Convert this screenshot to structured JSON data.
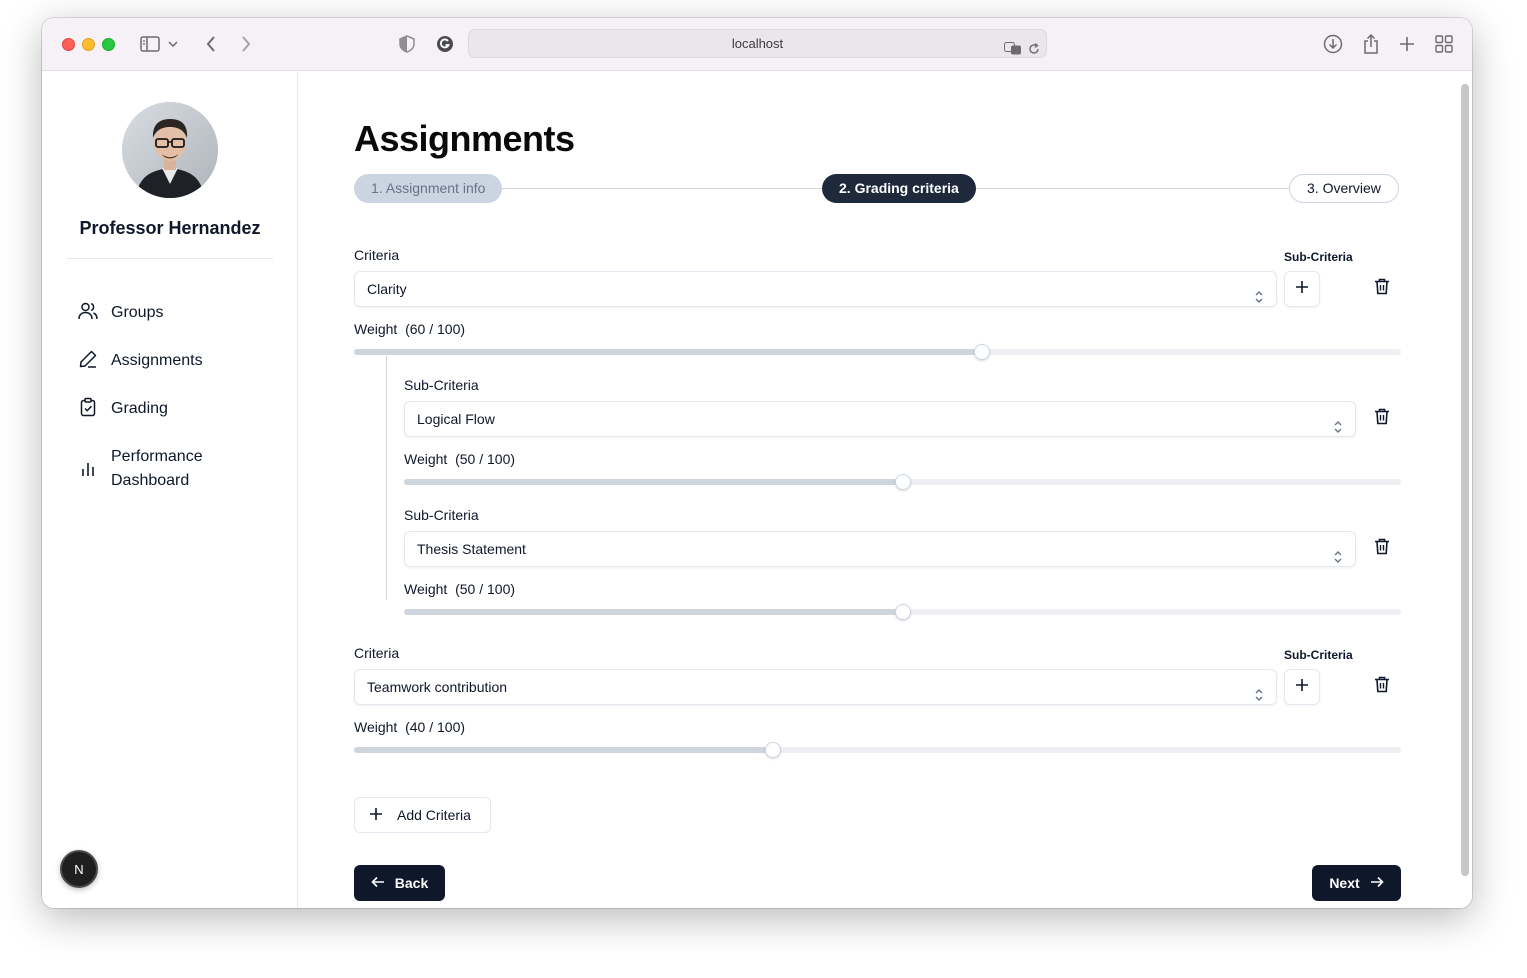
{
  "browser": {
    "url": "localhost"
  },
  "sidebar": {
    "user_name": "Professor Hernandez",
    "items": [
      {
        "label": "Groups",
        "icon": "users-icon"
      },
      {
        "label": "Assignments",
        "icon": "pencil-icon"
      },
      {
        "label": "Grading",
        "icon": "clipboard-check-icon"
      },
      {
        "label": "Performance Dashboard",
        "icon": "bar-chart-icon"
      }
    ],
    "badge": "N"
  },
  "main": {
    "title": "Assignments",
    "steps": [
      {
        "label": "1. Assignment info",
        "state": "done"
      },
      {
        "label": "2. Grading criteria",
        "state": "active"
      },
      {
        "label": "3. Overview",
        "state": "todo"
      }
    ],
    "criteria": [
      {
        "label": "Criteria",
        "sub_header": "Sub-Criteria",
        "value": "Clarity",
        "weight_label": "Weight",
        "weight_text": "(60 / 100)",
        "weight": 60,
        "sub_criteria": [
          {
            "label": "Sub-Criteria",
            "value": "Logical Flow",
            "weight_label": "Weight",
            "weight_text": "(50 / 100)",
            "weight": 50
          },
          {
            "label": "Sub-Criteria",
            "value": "Thesis Statement",
            "weight_label": "Weight",
            "weight_text": "(50 / 100)",
            "weight": 50
          }
        ]
      },
      {
        "label": "Criteria",
        "sub_header": "Sub-Criteria",
        "value": "Teamwork contribution",
        "weight_label": "Weight",
        "weight_text": "(40 / 100)",
        "weight": 40,
        "sub_criteria": []
      }
    ],
    "add_label": "Add Criteria",
    "back_label": "Back",
    "next_label": "Next"
  },
  "colors": {
    "primary": "#0f172a",
    "step_done_bg": "#cbd5e1",
    "border": "#e2e8f0"
  }
}
